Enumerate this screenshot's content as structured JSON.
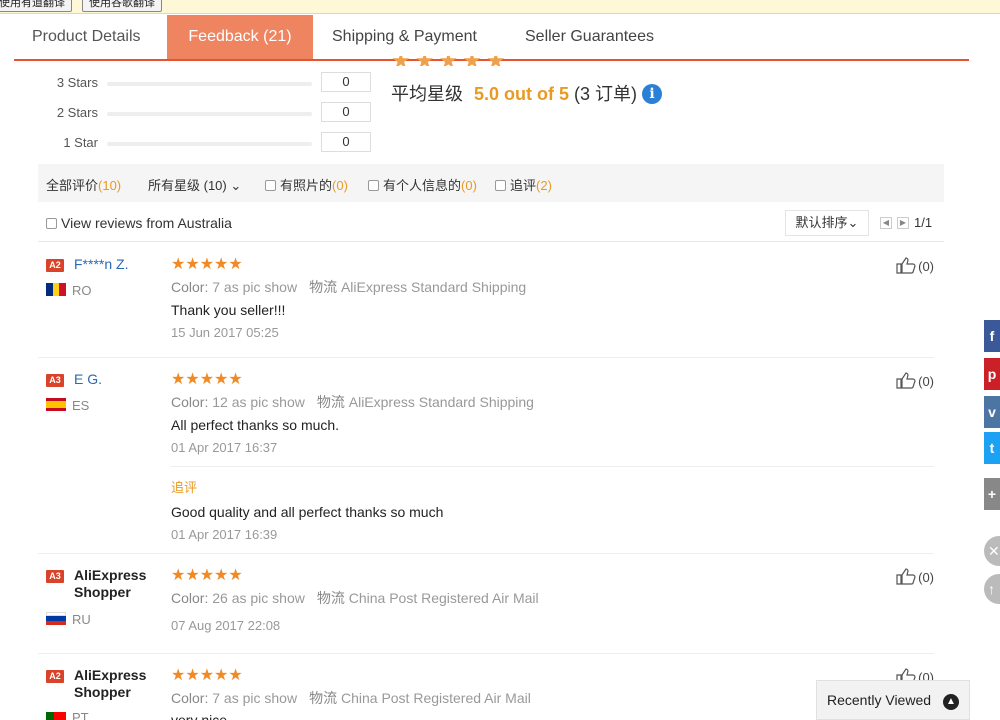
{
  "translation_bar": {
    "btn_auto": "使用有道翻译",
    "btn_google": "使用谷歌翻译"
  },
  "tabs": [
    {
      "label": "Product Details"
    },
    {
      "label": "Feedback (21)"
    },
    {
      "label": "Shipping & Payment"
    },
    {
      "label": "Seller Guarantees"
    }
  ],
  "star_breakdown": [
    {
      "label": "3 Stars",
      "count": "0"
    },
    {
      "label": "2 Stars",
      "count": "0"
    },
    {
      "label": "1 Star",
      "count": "0"
    }
  ],
  "summary": {
    "stars": "★★★★★",
    "avg_label": "平均星级",
    "score": "5.0 out of 5",
    "orders": "(3 订单)",
    "info_icon": "i"
  },
  "filters": {
    "all_label": "全部评价",
    "all_count": "(10)",
    "star_filter": "所有星级 (10)",
    "photo_label": "有照片的",
    "photo_count": "(0)",
    "personal_label": "有个人信息的",
    "personal_count": "(0)",
    "follow_label": "追评",
    "follow_count": "(2)"
  },
  "toolbar": {
    "australia_label": "View reviews from Australia",
    "sort_label": "默认排序",
    "page_count": "1/1"
  },
  "reviews": [
    {
      "badge": "A2",
      "name": "F****n Z.",
      "country": "RO",
      "stars": "★★★★★",
      "color_key": "Color:",
      "color_val": "7 as pic show",
      "ship_key": "物流",
      "ship_val": "AliExpress Standard Shipping",
      "text": "Thank you seller!!!",
      "date": "15 Jun 2017 05:25",
      "likes": "(0)"
    },
    {
      "badge": "A3",
      "name": "E G.",
      "country": "ES",
      "stars": "★★★★★",
      "color_key": "Color:",
      "color_val": "12 as pic show",
      "ship_key": "物流",
      "ship_val": "AliExpress Standard Shipping",
      "text": "All perfect thanks so much.",
      "date": "01 Apr 2017 16:37",
      "likes": "(0)",
      "followup_label": "追评",
      "followup_text": "Good quality and all perfect thanks so much",
      "followup_date": "01 Apr 2017 16:39"
    },
    {
      "badge": "A3",
      "name": "AliExpress Shopper",
      "country": "RU",
      "stars": "★★★★★",
      "color_key": "Color:",
      "color_val": "26 as pic show",
      "ship_key": "物流",
      "ship_val": "China Post Registered Air Mail",
      "date": "07 Aug 2017 22:08",
      "likes": "(0)"
    },
    {
      "badge": "A2",
      "name": "AliExpress Shopper",
      "country": "PT",
      "stars": "★★★★★",
      "color_key": "Color:",
      "color_val": "7 as pic show",
      "ship_key": "物流",
      "ship_val": "China Post Registered Air Mail",
      "text": "very nice",
      "likes": "(0)"
    }
  ],
  "share_icons": [
    "f",
    "p",
    "v",
    "t",
    "+"
  ],
  "recently_viewed": "Recently Viewed",
  "colors": {
    "accent": "#ef8461",
    "star": "#f08a24",
    "link": "#2a6ab4",
    "count": "#e89a24"
  }
}
